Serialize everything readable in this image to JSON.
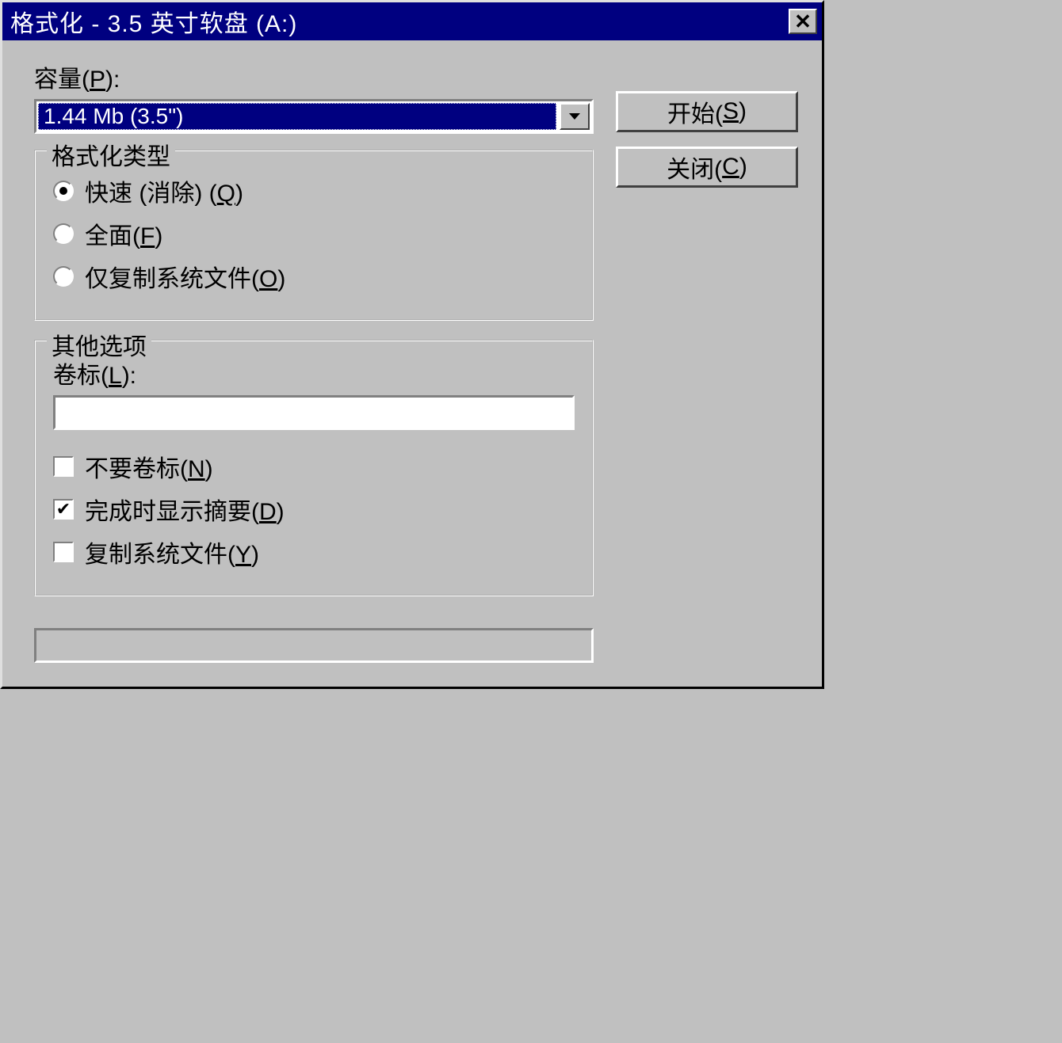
{
  "title": "格式化 - 3.5 英寸软盘 (A:)",
  "capacity": {
    "label_pre": "容量(",
    "label_key": "P",
    "label_post": "):",
    "value": "1.44 Mb (3.5\")"
  },
  "buttons": {
    "start_pre": "开始(",
    "start_key": "S",
    "start_post": ")",
    "close_pre": "关闭(",
    "close_key": "C",
    "close_post": ")"
  },
  "format_type": {
    "legend": "格式化类型",
    "options": [
      {
        "pre": "快速 (消除) (",
        "key": "Q",
        "post": ")",
        "checked": true
      },
      {
        "pre": "全面(",
        "key": "F",
        "post": ")",
        "checked": false
      },
      {
        "pre": "仅复制系统文件(",
        "key": "O",
        "post": ")",
        "checked": false
      }
    ]
  },
  "other_options": {
    "legend": "其他选项",
    "volume_label_pre": "卷标(",
    "volume_label_key": "L",
    "volume_label_post": "):",
    "volume_value": "",
    "checks": [
      {
        "pre": "不要卷标(",
        "key": "N",
        "post": ")",
        "checked": false
      },
      {
        "pre": "完成时显示摘要(",
        "key": "D",
        "post": ")",
        "checked": true
      },
      {
        "pre": "复制系统文件(",
        "key": "Y",
        "post": ")",
        "checked": false
      }
    ]
  }
}
